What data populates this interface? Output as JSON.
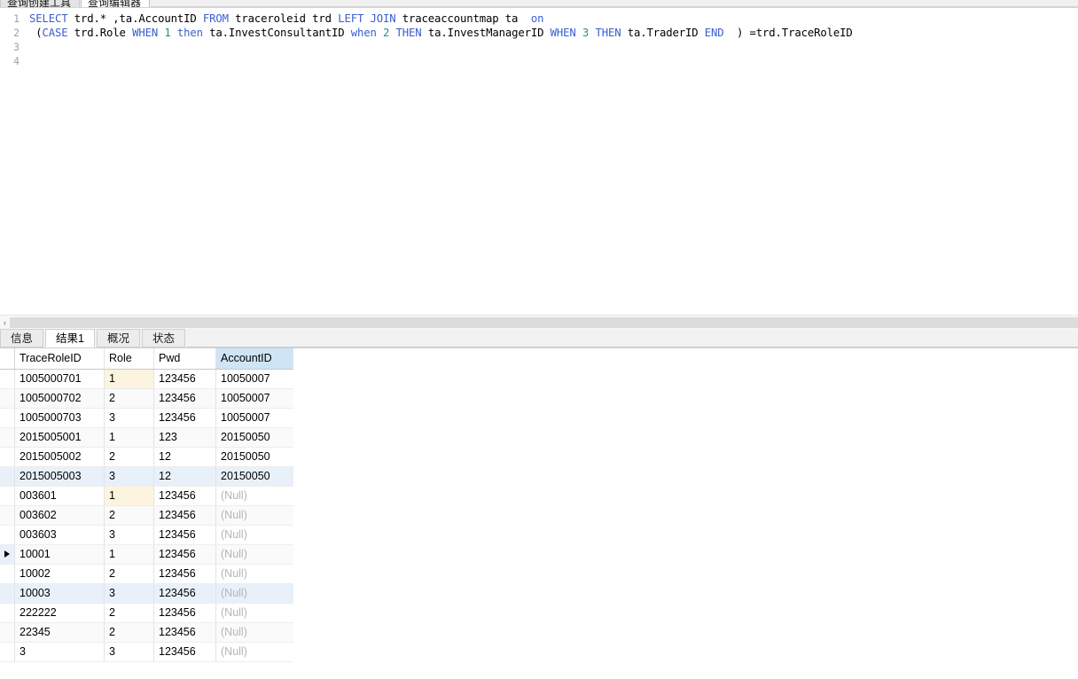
{
  "window": {
    "top_tabs": [
      {
        "label": "查询创建工具",
        "active": false
      },
      {
        "label": "查询编辑器",
        "active": true
      }
    ]
  },
  "editor": {
    "line_numbers": [
      "1",
      "2",
      "3",
      "4"
    ],
    "lines": [
      [
        {
          "t": "SELECT",
          "c": "kw"
        },
        {
          "t": " trd.* ,ta.AccountID ",
          "c": "id"
        },
        {
          "t": "FROM",
          "c": "kw"
        },
        {
          "t": " traceroleid trd ",
          "c": "id"
        },
        {
          "t": "LEFT",
          "c": "kw"
        },
        {
          "t": " ",
          "c": "id"
        },
        {
          "t": "JOIN",
          "c": "kw"
        },
        {
          "t": " traceaccountmap ta  ",
          "c": "id"
        },
        {
          "t": "on",
          "c": "kw"
        }
      ],
      [
        {
          "t": " (",
          "c": "id"
        },
        {
          "t": "CASE",
          "c": "kw"
        },
        {
          "t": " trd.Role ",
          "c": "id"
        },
        {
          "t": "WHEN",
          "c": "kw"
        },
        {
          "t": " ",
          "c": "id"
        },
        {
          "t": "1",
          "c": "num"
        },
        {
          "t": " ",
          "c": "id"
        },
        {
          "t": "then",
          "c": "kw"
        },
        {
          "t": " ta.InvestConsultantID ",
          "c": "id"
        },
        {
          "t": "when",
          "c": "kw"
        },
        {
          "t": " ",
          "c": "id"
        },
        {
          "t": "2",
          "c": "num"
        },
        {
          "t": " ",
          "c": "id"
        },
        {
          "t": "THEN",
          "c": "kw"
        },
        {
          "t": " ta.InvestManagerID ",
          "c": "id"
        },
        {
          "t": "WHEN",
          "c": "kw"
        },
        {
          "t": " ",
          "c": "id"
        },
        {
          "t": "3",
          "c": "num"
        },
        {
          "t": " ",
          "c": "id"
        },
        {
          "t": "THEN",
          "c": "kw"
        },
        {
          "t": " ta.TraderID ",
          "c": "id"
        },
        {
          "t": "END",
          "c": "kw"
        },
        {
          "t": "  ) =trd.TraceRoleID",
          "c": "id"
        }
      ],
      [],
      []
    ],
    "raw_text": "SELECT trd.* ,ta.AccountID FROM traceroleid trd LEFT JOIN traceaccountmap ta  on\n (CASE trd.Role WHEN 1 then ta.InvestConsultantID when 2 THEN ta.InvestManagerID WHEN 3 THEN ta.TraderID END  ) =trd.TraceRoleID"
  },
  "splitter": {
    "collapse_arrow": "‹"
  },
  "result_tabs": [
    {
      "label": "信息",
      "active": false
    },
    {
      "label": "结果1",
      "active": true
    },
    {
      "label": "概况",
      "active": false
    },
    {
      "label": "状态",
      "active": false
    }
  ],
  "grid": {
    "columns": [
      {
        "name": "TraceRoleID",
        "selected": false,
        "align": "left"
      },
      {
        "name": "Role",
        "selected": false,
        "align": "right"
      },
      {
        "name": "Pwd",
        "selected": false,
        "align": "left"
      },
      {
        "name": "AccountID",
        "selected": true,
        "align": "left"
      }
    ],
    "null_text": "(Null)",
    "rows": [
      {
        "cells": [
          "1005000701",
          "1",
          "123456",
          "10050007"
        ],
        "null_flags": [
          false,
          false,
          false,
          false
        ],
        "style": "plain",
        "role_hl": true,
        "current": false
      },
      {
        "cells": [
          "1005000702",
          "2",
          "123456",
          "10050007"
        ],
        "null_flags": [
          false,
          false,
          false,
          false
        ],
        "style": "alt",
        "role_hl": false,
        "current": false
      },
      {
        "cells": [
          "1005000703",
          "3",
          "123456",
          "10050007"
        ],
        "null_flags": [
          false,
          false,
          false,
          false
        ],
        "style": "plain",
        "role_hl": false,
        "current": false
      },
      {
        "cells": [
          "2015005001",
          "1",
          "123",
          "20150050"
        ],
        "null_flags": [
          false,
          false,
          false,
          false
        ],
        "style": "alt",
        "role_hl": true,
        "current": false
      },
      {
        "cells": [
          "2015005002",
          "2",
          "12",
          "20150050"
        ],
        "null_flags": [
          false,
          false,
          false,
          false
        ],
        "style": "plain",
        "role_hl": false,
        "current": false
      },
      {
        "cells": [
          "2015005003",
          "3",
          "12",
          "20150050"
        ],
        "null_flags": [
          false,
          false,
          false,
          false
        ],
        "style": "sel",
        "role_hl": false,
        "current": false
      },
      {
        "cells": [
          "003601",
          "1",
          "123456",
          "(Null)"
        ],
        "null_flags": [
          false,
          false,
          false,
          true
        ],
        "style": "plain",
        "role_hl": true,
        "current": false
      },
      {
        "cells": [
          "003602",
          "2",
          "123456",
          "(Null)"
        ],
        "null_flags": [
          false,
          false,
          false,
          true
        ],
        "style": "alt",
        "role_hl": false,
        "current": false
      },
      {
        "cells": [
          "003603",
          "3",
          "123456",
          "(Null)"
        ],
        "null_flags": [
          false,
          false,
          false,
          true
        ],
        "style": "plain",
        "role_hl": false,
        "current": false
      },
      {
        "cells": [
          "10001",
          "1",
          "123456",
          "(Null)"
        ],
        "null_flags": [
          false,
          false,
          false,
          true
        ],
        "style": "alt",
        "role_hl": true,
        "current": true
      },
      {
        "cells": [
          "10002",
          "2",
          "123456",
          "(Null)"
        ],
        "null_flags": [
          false,
          false,
          false,
          true
        ],
        "style": "plain",
        "role_hl": false,
        "current": false
      },
      {
        "cells": [
          "10003",
          "3",
          "123456",
          "(Null)"
        ],
        "null_flags": [
          false,
          false,
          false,
          true
        ],
        "style": "sel",
        "role_hl": false,
        "current": false
      },
      {
        "cells": [
          "222222",
          "2",
          "123456",
          "(Null)"
        ],
        "null_flags": [
          false,
          false,
          false,
          true
        ],
        "style": "plain",
        "role_hl": false,
        "current": false
      },
      {
        "cells": [
          "22345",
          "2",
          "123456",
          "(Null)"
        ],
        "null_flags": [
          false,
          false,
          false,
          true
        ],
        "style": "alt",
        "role_hl": false,
        "current": false
      },
      {
        "cells": [
          "3",
          "3",
          "123456",
          "(Null)"
        ],
        "null_flags": [
          false,
          false,
          false,
          true
        ],
        "style": "plain",
        "role_hl": false,
        "current": false
      }
    ]
  }
}
